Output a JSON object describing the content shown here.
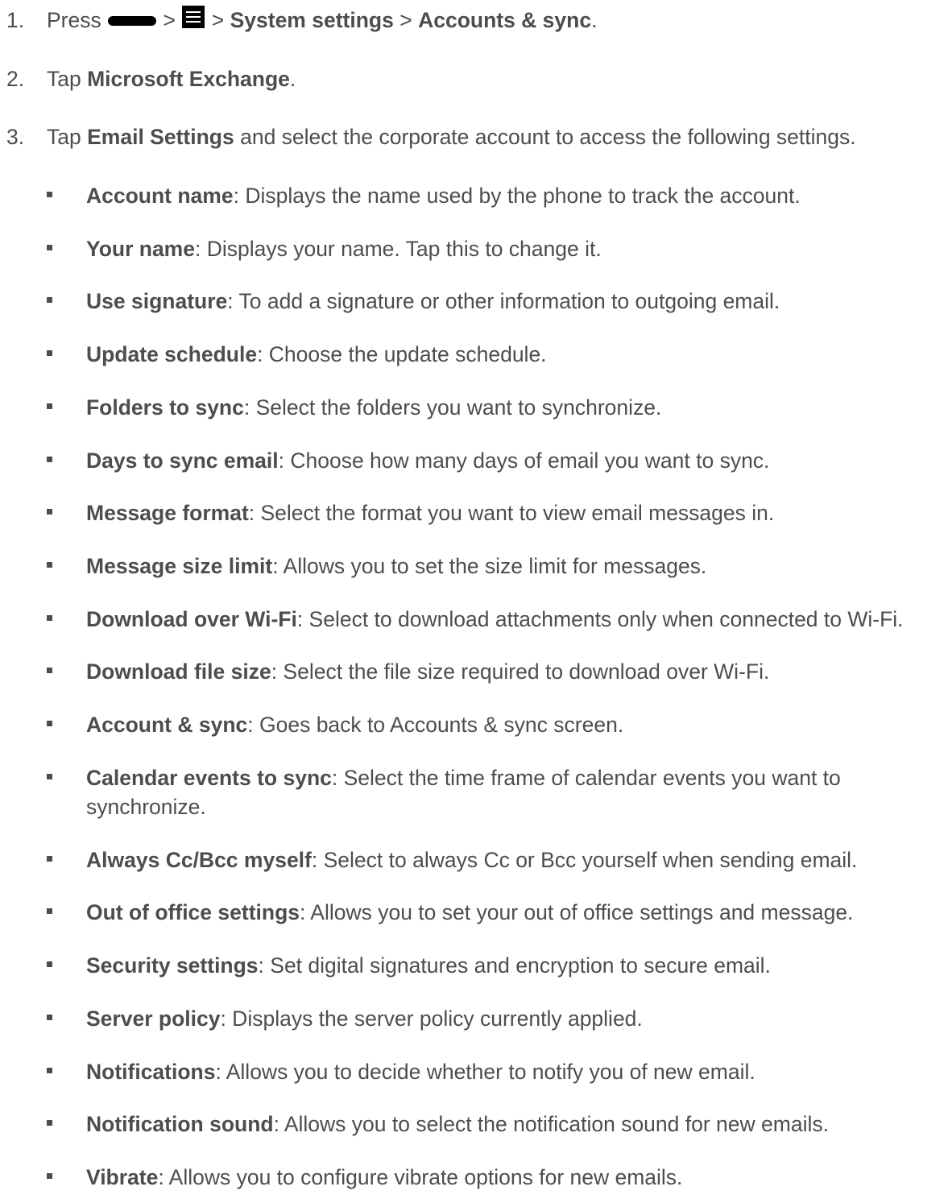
{
  "steps": [
    {
      "number": "1.",
      "prefix": "Press",
      "sep1": ">",
      "sep2": ">",
      "bold1": "System settings",
      "sep3": ">",
      "bold2": "Accounts & sync",
      "end": "."
    },
    {
      "number": "2.",
      "prefix": "Tap",
      "bold1": "Microsoft Exchange",
      "end": "."
    },
    {
      "number": "3.",
      "prefix": "Tap",
      "bold1": "Email Settings",
      "rest": "and select the corporate account to access the following settings."
    }
  ],
  "icons": {
    "home_key": "home-key-icon",
    "menu_key": "menu-icon"
  },
  "settings": [
    {
      "term": "Account name",
      "desc": ": Displays the name used by the phone to track the account."
    },
    {
      "term": "Your name",
      "desc": ": Displays your name. Tap this to change it."
    },
    {
      "term": "Use signature",
      "desc": ": To add a signature or other information to outgoing email."
    },
    {
      "term": "Update schedule",
      "desc": ": Choose the update schedule."
    },
    {
      "term": "Folders to sync",
      "desc": ": Select the folders you want to synchronize."
    },
    {
      "term": "Days to sync email",
      "desc": ": Choose how many days of email you want to sync."
    },
    {
      "term": "Message format",
      "desc": ": Select the format you want to view email messages in."
    },
    {
      "term": "Message size limit",
      "desc": ": Allows you to set the size limit for messages."
    },
    {
      "term": "Download over Wi-Fi",
      "desc": ": Select to download attachments only when connected to Wi-Fi."
    },
    {
      "term": "Download file size",
      "desc": ": Select the file size required to download over Wi-Fi."
    },
    {
      "term": "Account & sync",
      "desc": ": Goes back to Accounts & sync screen."
    },
    {
      "term": "Calendar events to sync",
      "desc": ": Select the time frame of calendar events you want to synchronize."
    },
    {
      "term": "Always Cc/Bcc myself",
      "desc": ": Select to always Cc or Bcc yourself when sending email."
    },
    {
      "term": "Out of office settings",
      "desc": ": Allows you to set your out of office settings and message."
    },
    {
      "term": "Security settings",
      "desc": ": Set digital signatures and encryption to secure email."
    },
    {
      "term": "Server policy",
      "desc": ": Displays the server policy currently applied."
    },
    {
      "term": "Notifications",
      "desc": ": Allows you to decide whether to notify you of new email."
    },
    {
      "term": "Notification sound",
      "desc": ": Allows you to select the notification sound for new emails."
    },
    {
      "term": "Vibrate",
      "desc": ": Allows you to configure vibrate options for new emails."
    }
  ]
}
